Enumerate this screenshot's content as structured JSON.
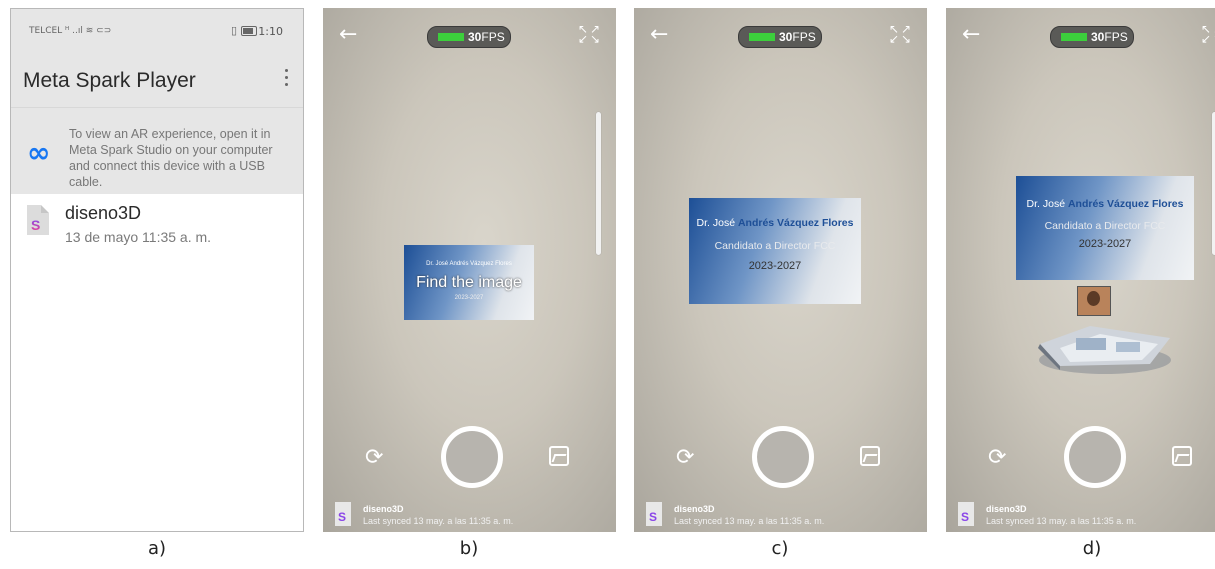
{
  "captions": [
    "a)",
    "b)",
    "c)",
    "d)"
  ],
  "panel_a": {
    "status": {
      "carrier": "TELCEL ᵸ ..ıl ≋ ⊂⊃",
      "time": "1:10"
    },
    "app_title": "Meta Spark Player",
    "info_text": "To view an AR experience, open it in Meta Spark Studio on your computer and connect this device with a USB cable.",
    "file": {
      "name": "diseno3D",
      "date": "13 de mayo 11:35 a. m."
    }
  },
  "camera": {
    "fps_value": "30",
    "fps_unit": "FPS",
    "project_name": "diseno3D",
    "synced": "Last synced 13 may. a las 11:35 a. m."
  },
  "card": {
    "line1_prefix": "Dr. José",
    "line1_name": "Andrés Vázquez Flores",
    "line2": "Candidato a Director FCC",
    "line3": "2023-2027"
  },
  "panel_b": {
    "overlay": "Find the image"
  }
}
